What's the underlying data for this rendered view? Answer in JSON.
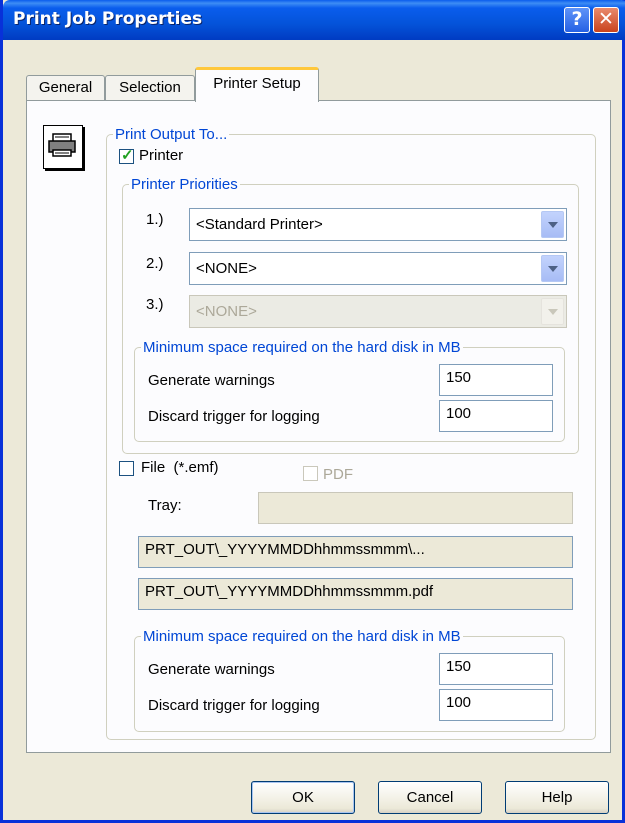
{
  "window": {
    "title": "Print Job Properties",
    "help_glyph": "?",
    "close_glyph": "✕"
  },
  "tabs": [
    {
      "label": "General",
      "active": false
    },
    {
      "label": "Selection",
      "active": false
    },
    {
      "label": "Printer Setup",
      "active": true
    }
  ],
  "print_output": {
    "legend": "Print Output To...",
    "printer_checkbox": {
      "label": "Printer",
      "checked": true
    },
    "priorities": {
      "legend": "Printer Priorities",
      "items": [
        {
          "index": "1.)",
          "value": "<Standard Printer>",
          "enabled": true
        },
        {
          "index": "2.)",
          "value": "<NONE>",
          "enabled": true
        },
        {
          "index": "3.)",
          "value": "<NONE>",
          "enabled": false
        }
      ]
    },
    "printer_space": {
      "legend": "Minimum space required on the hard disk in MB",
      "warnings_label": "Generate warnings",
      "warnings_value": "150",
      "discard_label": "Discard trigger for logging",
      "discard_value": "100"
    },
    "file_checkbox": {
      "label": "File  (*.emf)",
      "checked": false
    },
    "pdf_checkbox": {
      "label": "PDF",
      "checked": false,
      "enabled": false
    },
    "tray_label": "Tray:",
    "tray_value": "",
    "path_emf": "PRT_OUT\\_YYYYMMDDhhmmssmmm\\...",
    "path_pdf": "PRT_OUT\\_YYYYMMDDhhmmssmmm.pdf",
    "file_space": {
      "legend": "Minimum space required on the hard disk in MB",
      "warnings_label": "Generate warnings",
      "warnings_value": "150",
      "discard_label": "Discard trigger for logging",
      "discard_value": "100"
    }
  },
  "buttons": {
    "ok": "OK",
    "cancel": "Cancel",
    "help": "Help"
  },
  "colors": {
    "titlebar": "#0453d9",
    "legend": "#0046d5",
    "check": "#21a121"
  },
  "icons": {
    "printer": "printer-icon",
    "help": "help-icon",
    "close": "close-icon",
    "dropdown": "chevron-down-icon"
  }
}
